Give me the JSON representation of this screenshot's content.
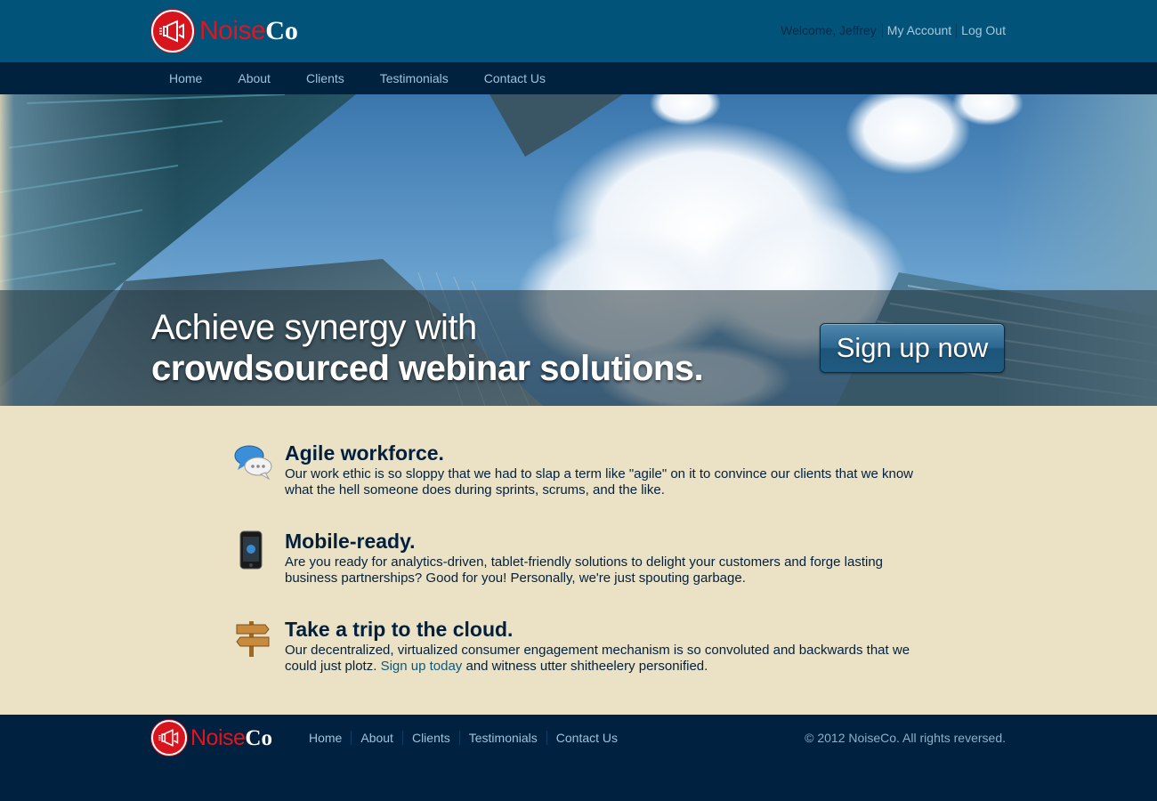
{
  "brand": {
    "name_part1": "Noise",
    "name_part2": "Co"
  },
  "user_nav": {
    "welcome": "Welcome, Jeffrey",
    "my_account": "My Account",
    "log_out": "Log Out"
  },
  "main_nav": {
    "items": [
      "Home",
      "About",
      "Clients",
      "Testimonials",
      "Contact Us"
    ]
  },
  "hero": {
    "line1": "Achieve synergy with",
    "line2": "crowdsourced webinar solutions.",
    "cta": "Sign up now"
  },
  "features": [
    {
      "icon": "chat-bubbles-icon",
      "title": "Agile workforce.",
      "text": "Our work ethic is so sloppy that we had to slap a term like \"agile\" on it to convince our clients that we know what the hell someone does during sprints, scrums, and the like."
    },
    {
      "icon": "smartphone-icon",
      "title": "Mobile-ready.",
      "text": "Are you ready for analytics-driven, tablet-friendly solutions to delight your customers and forge lasting business partnerships? Good for you! Personally, we're just spouting garbage."
    },
    {
      "icon": "signpost-icon",
      "title": "Take a trip to the cloud.",
      "text_before": "Our decentralized, virtualized consumer engagement mechanism is so convoluted and backwards that we could just plotz. ",
      "link": "Sign up today",
      "text_after": " and witness utter shitheelery personified."
    }
  ],
  "footer": {
    "nav": [
      "Home",
      "About",
      "Clients",
      "Testimonials",
      "Contact Us"
    ],
    "copyright": "© 2012 NoiseCo. All rights reversed."
  },
  "colors": {
    "header": "#02537a",
    "nav": "#00223f",
    "features_bg": "#ebe2c6",
    "brand_red": "#e3141c",
    "text_dark": "#02203e"
  }
}
